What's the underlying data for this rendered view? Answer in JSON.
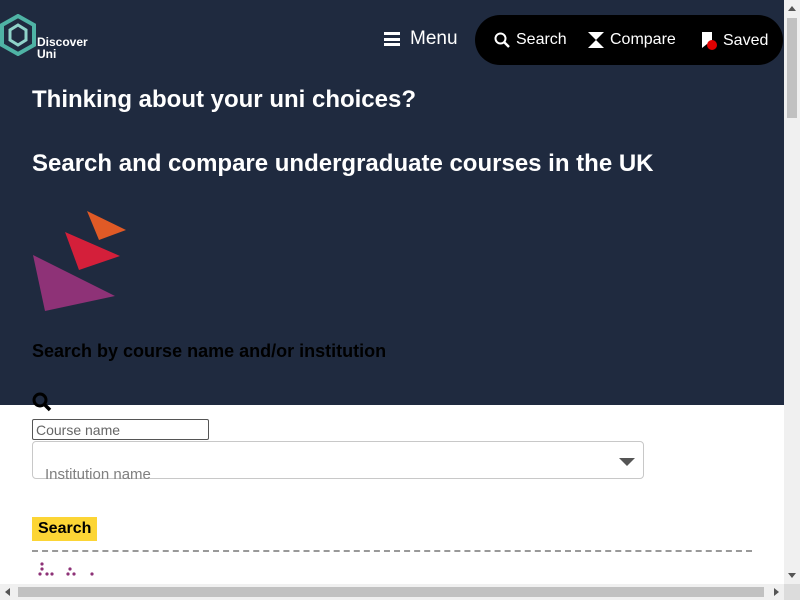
{
  "brand": {
    "logo_line1": "Discover",
    "logo_line2": "Uni"
  },
  "nav": {
    "menu_label": "Menu",
    "search_label": "Search",
    "compare_label": "Compare",
    "saved_label": "Saved"
  },
  "hero": {
    "heading": "Thinking about your uni choices?",
    "subheading": "Search and compare undergraduate courses in the UK"
  },
  "search": {
    "section_label": "Search by course name and/or institution",
    "course_placeholder": "Course name",
    "institution_placeholder": "Institution name",
    "submit_label": "Search"
  },
  "colors": {
    "hero_bg": "#1f2a3f",
    "nav_pill": "#000000",
    "button_yellow": "#fcd535",
    "saved_badge": "#e00000"
  },
  "icons": [
    "menu-icon",
    "search-icon",
    "compare-icon",
    "bookmark-icon",
    "magnifier-icon",
    "chevron-down-icon"
  ]
}
